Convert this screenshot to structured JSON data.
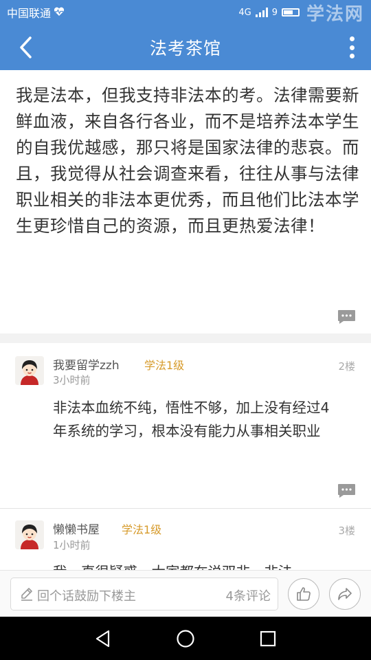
{
  "status_bar": {
    "carrier": "中国联通",
    "network": "4G",
    "time": "9",
    "watermark": "学法网"
  },
  "nav": {
    "title": "法考茶馆"
  },
  "post": {
    "body": "我是法本，但我支持非法本的考。法律需要新鲜血液，来自各行各业，而不是培养法本学生的自我优越感，那只将是国家法律的悲哀。而且，我觉得从社会调查来看，往往从事与法律职业相关的非法本更优秀，而且他们比法本学生更珍惜自己的资源，而且更热爱法律！"
  },
  "replies": [
    {
      "username": "我要留学zzh",
      "level": "学法1级",
      "time": "3小时前",
      "floor": "2楼",
      "text": "非法本血统不纯，悟性不够，加上没有经过4年系统的学习，根本没有能力从事相关职业"
    },
    {
      "username": "懒懒书屋",
      "level": "学法1级",
      "time": "1小时前",
      "floor": "3楼",
      "text": "我一直很疑惑，大家都在说双非，非法"
    }
  ],
  "bottom_bar": {
    "placeholder": "回个话鼓励下楼主",
    "comment_count": "4条评论"
  },
  "colors": {
    "accent": "#4a8ad4",
    "level": "#d69a2a"
  }
}
